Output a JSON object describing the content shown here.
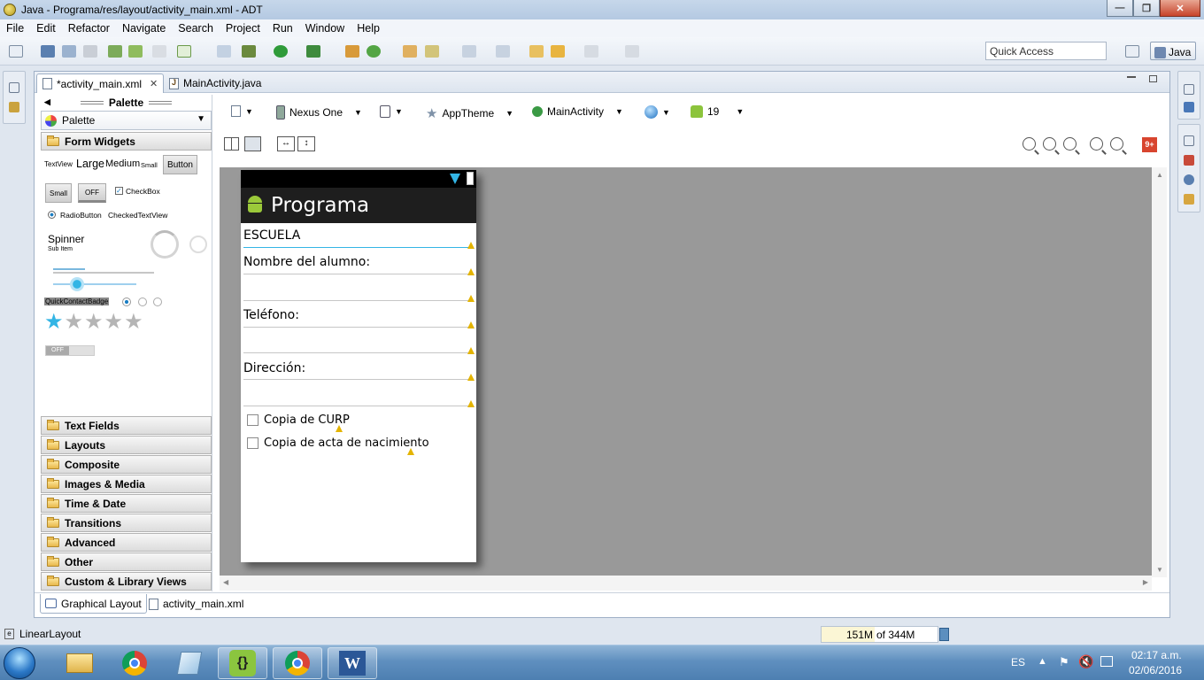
{
  "window": {
    "title": "Java - Programa/res/layout/activity_main.xml - ADT",
    "minimize_glyph": "—",
    "maximize_glyph": "❐",
    "close_glyph": "✕"
  },
  "menu": [
    "File",
    "Edit",
    "Refactor",
    "Navigate",
    "Search",
    "Project",
    "Run",
    "Window",
    "Help"
  ],
  "toolbar": {
    "quick_access": "Quick Access",
    "perspective": "Java"
  },
  "editor_tabs": [
    {
      "label": "*activity_main.xml",
      "close": "✕"
    },
    {
      "label": "MainActivity.java"
    }
  ],
  "palette": {
    "header": "Palette",
    "selector": "Palette",
    "open_category": "Form Widgets",
    "widgets": {
      "textview": "TextView",
      "large": "Large",
      "medium": "Medium",
      "small": "Small",
      "button": "Button",
      "small_button": "Small",
      "toggle_off": "OFF",
      "checkbox": "CheckBox",
      "radiobutton": "RadioButton",
      "checked_textview": "CheckedTextView",
      "spinner": "Spinner",
      "spinner_sub": "Sub Item",
      "quick_contact": "QuickContactBadge",
      "switch_off": "OFF",
      "rating_filled": 1,
      "rating_total": 5
    },
    "categories": [
      "Text Fields",
      "Layouts",
      "Composite",
      "Images & Media",
      "Time & Date",
      "Transitions",
      "Advanced",
      "Other",
      "Custom & Library Views"
    ]
  },
  "layout_toolbar": {
    "device": "Nexus One",
    "theme": "AppTheme",
    "activity": "MainActivity",
    "api_level": "19",
    "error_badge": "9+"
  },
  "preview": {
    "app_title": "Programa",
    "fields": [
      "ESCUELA",
      "Nombre del alumno:",
      "Teléfono:",
      "Dirección:"
    ],
    "checkboxes": [
      "Copia de CURP",
      "Copia de acta de nacimiento"
    ]
  },
  "bottom_tabs": [
    "Graphical Layout",
    "activity_main.xml"
  ],
  "status": {
    "selection": "LinearLayout",
    "heap_used": "151M",
    "heap_total": "of 344M"
  },
  "taskbar": {
    "lang": "ES",
    "time": "02:17 a.m.",
    "date": "02/06/2016"
  },
  "colors": {
    "accent": "#33b5e5",
    "actionbar": "#1e1e1e",
    "canvas": "#999999",
    "warning": "#e4b400"
  }
}
